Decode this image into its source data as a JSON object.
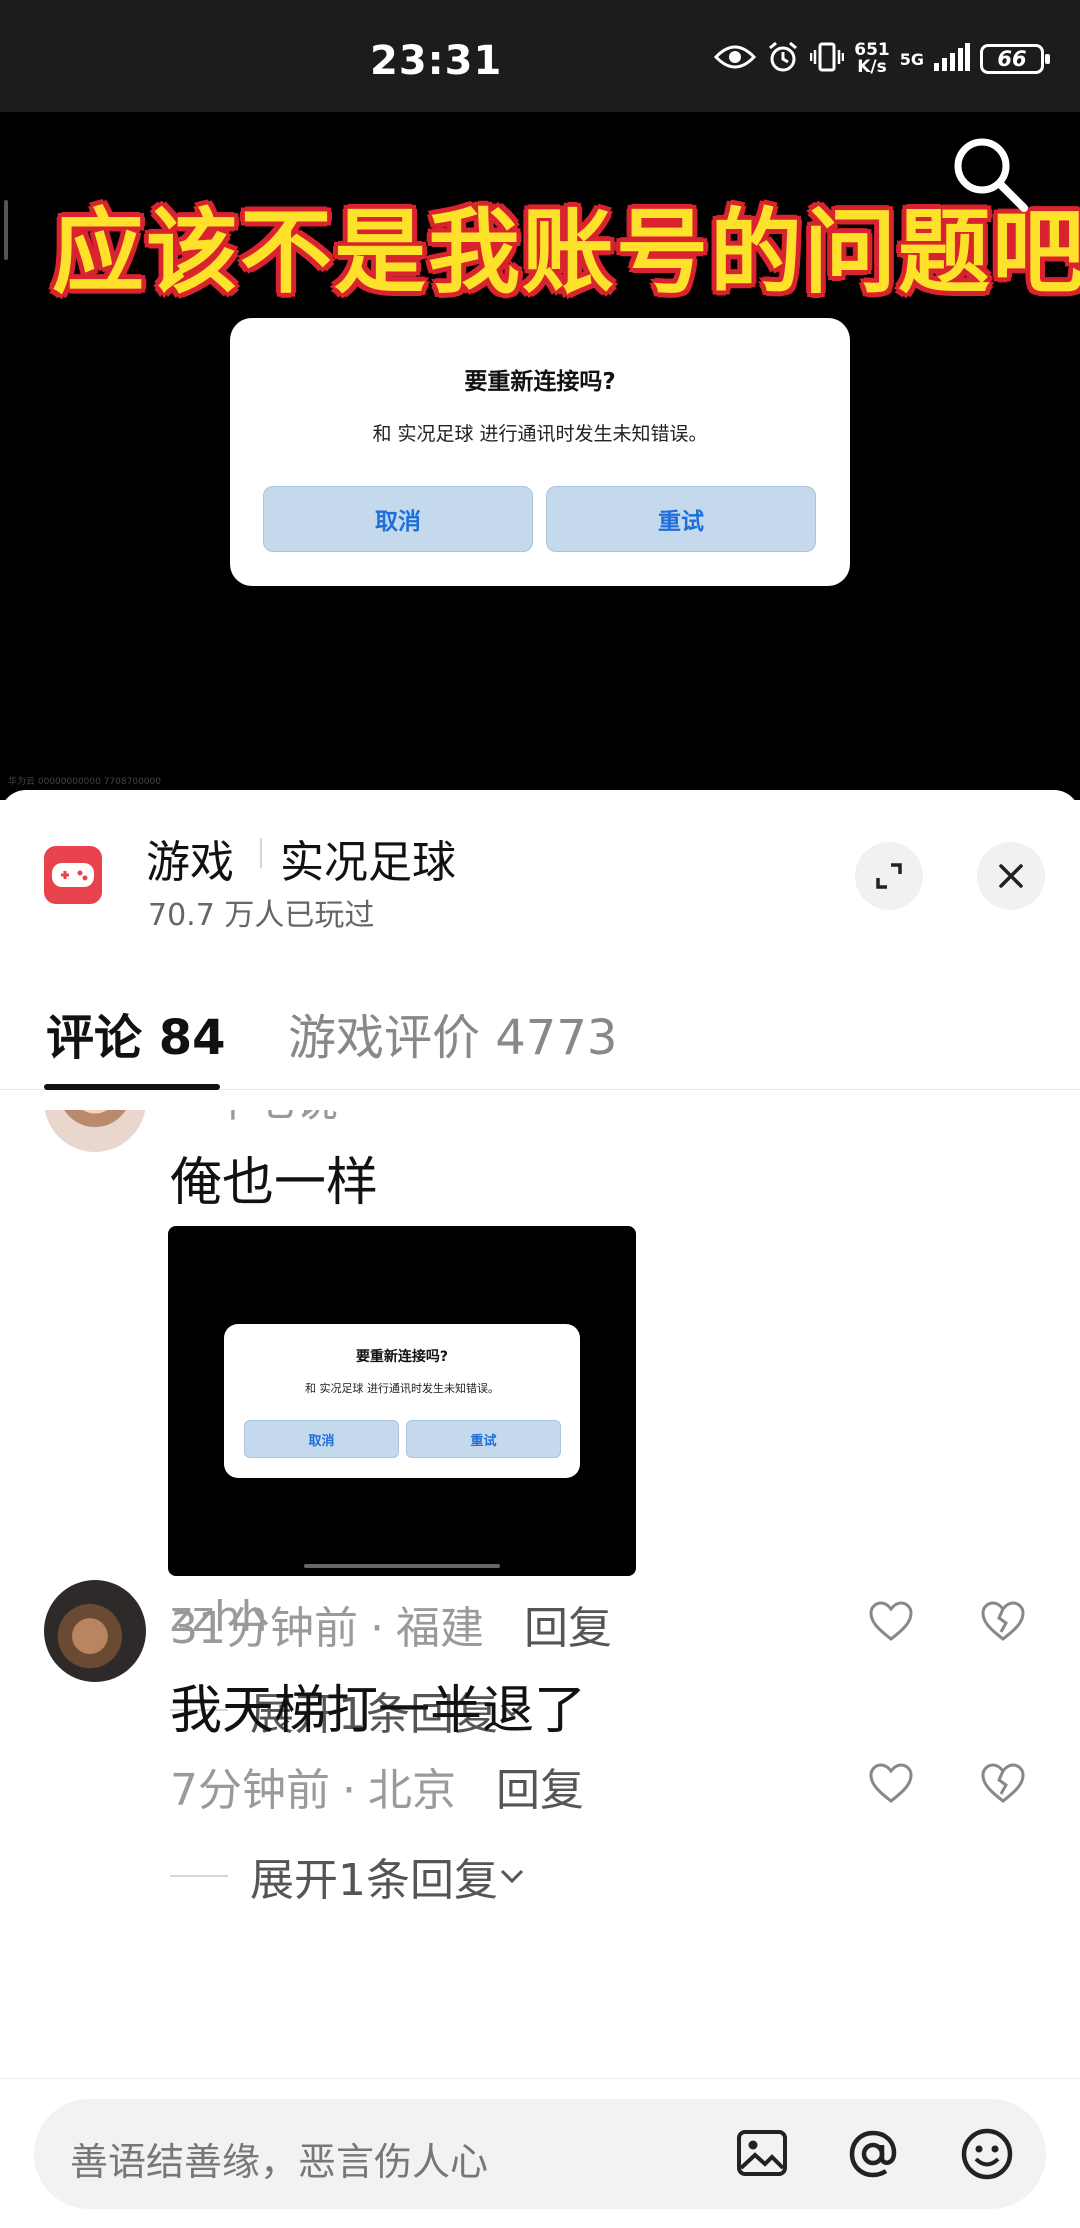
{
  "status_bar": {
    "time": "23:31",
    "net_speed_value": "651",
    "net_speed_unit": "K/s",
    "network": "5G",
    "battery": "66"
  },
  "video": {
    "caption": "应该不是我账号的问题吧",
    "dialog": {
      "title": "要重新连接吗?",
      "message": "和 实况足球 进行通讯时发生未知错误。",
      "cancel": "取消",
      "retry": "重试"
    },
    "watermark": "华为云 00000000000 7708700000"
  },
  "header": {
    "category": "游戏",
    "game_name": "实况足球",
    "players": "70.7 万人已玩过",
    "icon": "gamepad-icon"
  },
  "tabs": {
    "comments": "评论 84",
    "reviews": "游戏评价 4773"
  },
  "comments": [
    {
      "author": "一千七说",
      "text": "俺也一样",
      "image_dialog": {
        "title": "要重新连接吗?",
        "message": "和 实况足球 进行通讯时发生未知错误。",
        "cancel": "取消",
        "retry": "重试"
      },
      "time": "31分钟前",
      "location": "福建",
      "reply": "回复",
      "expand": "展开1条回复"
    },
    {
      "author": "zzhh",
      "text": "我天梯打一半退了",
      "time": "7分钟前",
      "location": "北京",
      "reply": "回复",
      "expand": "展开1条回复"
    }
  ],
  "input": {
    "placeholder": "善语结善缘，恶言伤人心"
  }
}
